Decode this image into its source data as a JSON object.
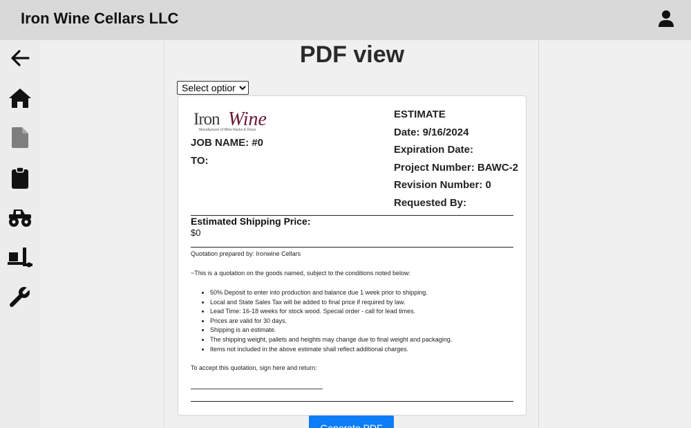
{
  "header": {
    "app_title": "Iron Wine Cellars LLC",
    "user_icon": "user-icon"
  },
  "sidebar": {
    "items": [
      {
        "icon": "arrow-left-icon"
      },
      {
        "icon": "home-icon"
      },
      {
        "icon": "document-icon",
        "state": "disabled"
      },
      {
        "icon": "clipboard-icon"
      },
      {
        "icon": "monster-truck-icon"
      },
      {
        "icon": "hand-truck-icon"
      },
      {
        "icon": "wrench-icon"
      }
    ]
  },
  "main": {
    "page_title": "PDF view",
    "select_value": "Select option",
    "generate_label": "Generate PDF"
  },
  "estimate": {
    "logo": {
      "text_iron": "Iron",
      "text_wine": "Wine",
      "subtitle": "Manufacturer of Wine Racks & Doors"
    },
    "job_name": "JOB NAME: #0",
    "to": "TO:",
    "estimate_label": "ESTIMATE",
    "date": "Date: 9/16/2024",
    "expiration": "Expiration Date:",
    "project_number": "Project Number: BAWC-2",
    "revision_number": "Revision Number: 0",
    "requested_by": "Requested By:",
    "shipping_label": "Estimated Shipping Price:",
    "shipping_value": "$0",
    "prepared_by": "Quotation prepared by: Ironwine Cellars",
    "intro": "~This is a quotation on the goods named, subject to the conditions noted below:",
    "terms": [
      "50% Deposit to enter into production and balance due 1 week prior to shipping.",
      "Local and State Sales Tax will be added to final price if required by law.",
      "Lead Time: 16-18 weeks for stock wood. Special order - call for lead times.",
      "Prices are valid for 30 days.",
      "Shipping is an estimate.",
      "The shipping weight, pallets and heights may change due to final weight and packaging.",
      "Items not included in the above estimate shall reflect additional charges."
    ],
    "accept": "To accept this quotation, sign here and return:"
  },
  "colors": {
    "topbar": "#d9d9d9",
    "button": "#0d7df5",
    "logo_wine": "#6b1830"
  }
}
